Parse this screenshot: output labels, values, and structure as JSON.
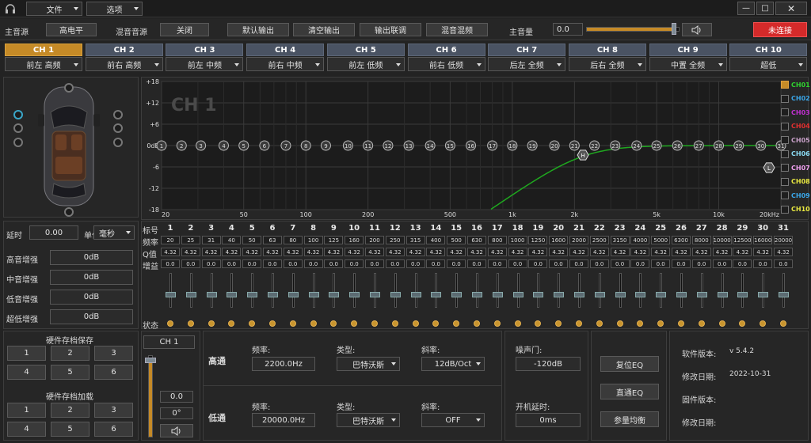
{
  "titlebar": {
    "menu_file": "文件",
    "menu_options": "选项",
    "headphone_icon": "headphone-icon"
  },
  "toolbar": {
    "main_source_label": "主音源",
    "high_level_button": "高电平",
    "mix_source_label": "混音音源",
    "mix_off_button": "关闭",
    "default_output_button": "默认输出",
    "clear_output_button": "清空输出",
    "output_link_button": "输出联调",
    "mix_button": "混音混频",
    "main_volume_label": "主音量",
    "main_volume_value": "0.0",
    "main_volume_level": 0.95,
    "status_button": "未连接",
    "status_color": "#d42a2a"
  },
  "channels": [
    {
      "name": "CH 1",
      "pos": "前左 高频"
    },
    {
      "name": "CH 2",
      "pos": "前右 高频"
    },
    {
      "name": "CH 3",
      "pos": "前左 中频"
    },
    {
      "name": "CH 4",
      "pos": "前右 中频"
    },
    {
      "name": "CH 5",
      "pos": "前左 低频"
    },
    {
      "name": "CH 6",
      "pos": "前右 低频"
    },
    {
      "name": "CH 7",
      "pos": "后左 全频"
    },
    {
      "name": "CH 8",
      "pos": "后右 全频"
    },
    {
      "name": "CH 9",
      "pos": "中置 全频"
    },
    {
      "name": "CH 10",
      "pos": "超低"
    }
  ],
  "graph": {
    "watermark": "CH 1",
    "y_ticks": [
      "+18",
      "+12",
      "+6",
      "0dB",
      "-6",
      "-12",
      "-18"
    ],
    "x_ticks": [
      "20",
      "50",
      "100",
      "200",
      "500",
      "1k",
      "2k",
      "5k",
      "10k",
      "20kHz"
    ],
    "hp_marker": "H",
    "lp_marker": "L"
  },
  "legend": [
    {
      "label": "CH01",
      "color": "#2fd12f",
      "checked": true
    },
    {
      "label": "CH02",
      "color": "#3aa6e8",
      "checked": false
    },
    {
      "label": "CH03",
      "color": "#c02fd0",
      "checked": false
    },
    {
      "label": "CH04",
      "color": "#e03030",
      "checked": false
    },
    {
      "label": "CH05",
      "color": "#c8a0c8",
      "checked": false
    },
    {
      "label": "CH06",
      "color": "#8ad8f0",
      "checked": false
    },
    {
      "label": "CH07",
      "color": "#f0a0f0",
      "checked": false
    },
    {
      "label": "CH08",
      "color": "#e8e840",
      "checked": false
    },
    {
      "label": "CH09",
      "color": "#3aa6e8",
      "checked": false
    },
    {
      "label": "CH10",
      "color": "#e8e840",
      "checked": false
    }
  ],
  "left": {
    "delay_label": "延时",
    "delay_value": "0.00",
    "unit_label": "单位",
    "unit_value": "毫秒",
    "gains": [
      {
        "label": "高音增强",
        "value": "0dB"
      },
      {
        "label": "中音增强",
        "value": "0dB"
      },
      {
        "label": "低音增强",
        "value": "0dB"
      },
      {
        "label": "超低增强",
        "value": "0dB"
      }
    ],
    "save_title": "硬件存档保存",
    "load_title": "硬件存档加载",
    "presets": [
      "1",
      "2",
      "3",
      "4",
      "5",
      "6"
    ]
  },
  "eq_labels": {
    "band": "标号",
    "freq": "频率",
    "q": "Q值",
    "gain": "增益",
    "state": "状态"
  },
  "eq_bands": [
    {
      "n": "1",
      "f": "20"
    },
    {
      "n": "2",
      "f": "25"
    },
    {
      "n": "3",
      "f": "31"
    },
    {
      "n": "4",
      "f": "40"
    },
    {
      "n": "5",
      "f": "50"
    },
    {
      "n": "6",
      "f": "63"
    },
    {
      "n": "7",
      "f": "80"
    },
    {
      "n": "8",
      "f": "100"
    },
    {
      "n": "9",
      "f": "125"
    },
    {
      "n": "10",
      "f": "160"
    },
    {
      "n": "11",
      "f": "200"
    },
    {
      "n": "12",
      "f": "250"
    },
    {
      "n": "13",
      "f": "315"
    },
    {
      "n": "14",
      "f": "400"
    },
    {
      "n": "15",
      "f": "500"
    },
    {
      "n": "16",
      "f": "630"
    },
    {
      "n": "17",
      "f": "800"
    },
    {
      "n": "18",
      "f": "1000"
    },
    {
      "n": "19",
      "f": "1250"
    },
    {
      "n": "20",
      "f": "1600"
    },
    {
      "n": "21",
      "f": "2000"
    },
    {
      "n": "22",
      "f": "2500"
    },
    {
      "n": "23",
      "f": "3150"
    },
    {
      "n": "24",
      "f": "4000"
    },
    {
      "n": "25",
      "f": "5000"
    },
    {
      "n": "26",
      "f": "6300"
    },
    {
      "n": "27",
      "f": "8000"
    },
    {
      "n": "28",
      "f": "10000"
    },
    {
      "n": "29",
      "f": "12500"
    },
    {
      "n": "30",
      "f": "16000"
    },
    {
      "n": "31",
      "f": "20000"
    }
  ],
  "eq_q": "4.32",
  "eq_gain": "0.0",
  "bottom": {
    "channel_select": "CH 1",
    "fader_value": "0.0",
    "phase_value": "0°",
    "hp_label": "高通",
    "lp_label": "低通",
    "freq_label": "频率:",
    "type_label": "类型:",
    "slope_label": "斜率:",
    "hp_freq": "2200.0Hz",
    "hp_type": "巴特沃斯",
    "hp_slope": "12dB/Oct",
    "lp_freq": "20000.0Hz",
    "lp_type": "巴特沃斯",
    "lp_slope": "OFF",
    "noise_gate_label": "噪声门:",
    "noise_gate_value": "-120dB",
    "power_delay_label": "开机延时:",
    "power_delay_value": "0ms",
    "reset_eq_button": "复位EQ",
    "direct_eq_button": "直通EQ",
    "param_eq_button": "参量均衡",
    "sw_version_label": "软件版本:",
    "sw_version_value": "v 5.4.2",
    "date_label": "修改日期:",
    "date_value": "2022-10-31",
    "fw_version_label": "固件版本:",
    "fw_version_value": "",
    "date2_label": "修改日期:",
    "date2_value": ""
  }
}
